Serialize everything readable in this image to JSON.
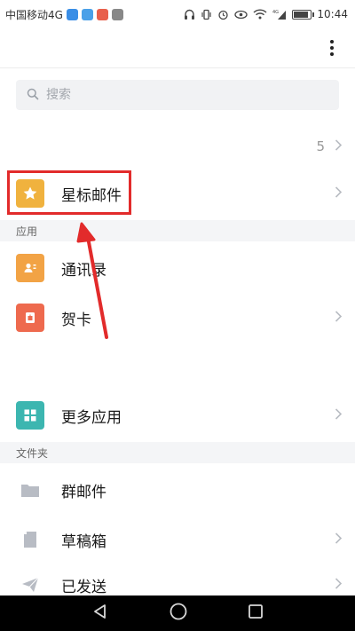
{
  "status_bar": {
    "carrier": "中国移动4G",
    "network": "4G",
    "time": "10:44",
    "battery_level": 0.85
  },
  "header": {
    "menu_icon": "more-vert-icon"
  },
  "search": {
    "placeholder": "搜索"
  },
  "inbox_row": {
    "count": "5"
  },
  "starred": {
    "label": "星标邮件",
    "icon": "star-icon"
  },
  "apps_section": {
    "title": "应用",
    "items": [
      {
        "label": "通讯录",
        "icon": "contact-card-icon",
        "color": "#f2a345"
      },
      {
        "label": "贺卡",
        "icon": "greeting-card-icon",
        "color": "#ee6a4e"
      },
      {
        "label": "更多应用",
        "icon": "grid-apps-icon",
        "color": "#3cb6b0"
      }
    ]
  },
  "folders_section": {
    "title": "文件夹",
    "items": [
      {
        "label": "群邮件",
        "icon": "folder-icon"
      },
      {
        "label": "草稿箱",
        "icon": "draft-icon"
      },
      {
        "label": "已发送",
        "icon": "sent-icon"
      }
    ]
  },
  "colors": {
    "accent_red": "#e22b2b",
    "starred_icon_bg": "#f0b23e",
    "section_bg": "#f4f5f7",
    "folder_icon": "#b8bcc4"
  },
  "nav_bar": {
    "back_icon": "back-triangle-icon",
    "home_icon": "home-circle-icon",
    "recents_icon": "recents-square-icon"
  }
}
